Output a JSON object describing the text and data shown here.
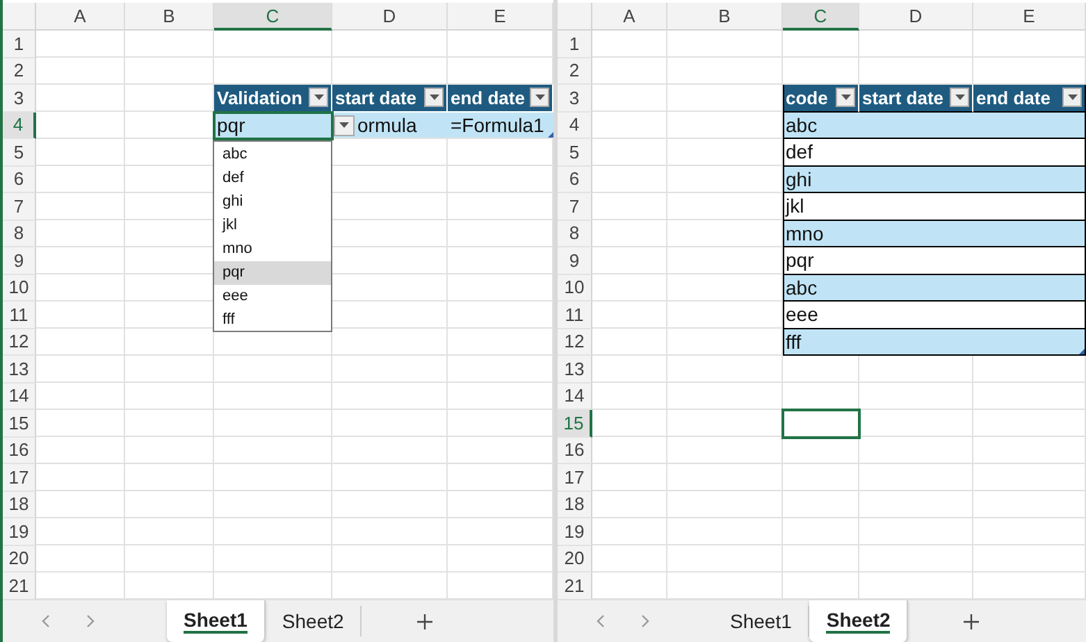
{
  "panes": [
    {
      "columns": [
        {
          "label": "A",
          "selected": false
        },
        {
          "label": "B",
          "selected": false
        },
        {
          "label": "C",
          "selected": true
        },
        {
          "label": "D",
          "selected": false
        },
        {
          "label": "E",
          "selected": false
        }
      ],
      "rows": [
        {
          "label": "1",
          "selected": false
        },
        {
          "label": "2",
          "selected": false
        },
        {
          "label": "3",
          "selected": false,
          "cells": [
            {
              "kind": "empty"
            },
            {
              "kind": "empty"
            },
            {
              "kind": "header",
              "text": "Validation"
            },
            {
              "kind": "header",
              "text": "start date"
            },
            {
              "kind": "header",
              "text": "end date"
            }
          ]
        },
        {
          "label": "4",
          "selected": true,
          "cells": [
            {
              "kind": "empty"
            },
            {
              "kind": "empty"
            },
            {
              "kind": "value",
              "text": "pqr",
              "banded": true,
              "active": true,
              "dropdown": {
                "items": [
                  {
                    "label": "abc",
                    "selected": false
                  },
                  {
                    "label": "def",
                    "selected": false
                  },
                  {
                    "label": "ghi",
                    "selected": false
                  },
                  {
                    "label": "jkl",
                    "selected": false
                  },
                  {
                    "label": "mno",
                    "selected": false
                  },
                  {
                    "label": "pqr",
                    "selected": true
                  },
                  {
                    "label": "eee",
                    "selected": false
                  },
                  {
                    "label": "fff",
                    "selected": false
                  }
                ]
              }
            },
            {
              "kind": "value",
              "text": "ormula",
              "banded": true
            },
            {
              "kind": "value",
              "text": "=Formula1",
              "banded": true,
              "corner_handle": true
            }
          ]
        },
        {
          "label": "5",
          "selected": false
        },
        {
          "label": "6",
          "selected": false
        },
        {
          "label": "7",
          "selected": false
        },
        {
          "label": "8",
          "selected": false
        },
        {
          "label": "9",
          "selected": false
        },
        {
          "label": "10",
          "selected": false
        },
        {
          "label": "11",
          "selected": false
        },
        {
          "label": "12",
          "selected": false
        },
        {
          "label": "13",
          "selected": false
        },
        {
          "label": "14",
          "selected": false
        },
        {
          "label": "15",
          "selected": false
        },
        {
          "label": "16",
          "selected": false
        },
        {
          "label": "17",
          "selected": false
        },
        {
          "label": "18",
          "selected": false
        },
        {
          "label": "19",
          "selected": false
        },
        {
          "label": "20",
          "selected": false
        },
        {
          "label": "21",
          "selected": false
        }
      ],
      "sheet_tabs": [
        {
          "label": "Sheet1",
          "selected": true
        },
        {
          "label": "Sheet2",
          "selected": false
        }
      ]
    },
    {
      "columns": [
        {
          "label": "A",
          "selected": false
        },
        {
          "label": "B",
          "selected": false
        },
        {
          "label": "C",
          "selected": true
        },
        {
          "label": "D",
          "selected": false
        },
        {
          "label": "E",
          "selected": false
        }
      ],
      "rows": [
        {
          "label": "1",
          "selected": false
        },
        {
          "label": "2",
          "selected": false
        },
        {
          "label": "3",
          "selected": false,
          "cells": [
            {
              "kind": "empty"
            },
            {
              "kind": "empty"
            },
            {
              "kind": "header",
              "text": "code",
              "outlined": true
            },
            {
              "kind": "header",
              "text": "start date",
              "outlined": true
            },
            {
              "kind": "header",
              "text": "end date",
              "outlined": true
            }
          ]
        },
        {
          "label": "4",
          "selected": false,
          "cells": [
            {
              "kind": "empty"
            },
            {
              "kind": "empty"
            },
            {
              "kind": "value",
              "text": "abc",
              "banded": true,
              "outlined": true
            },
            {
              "kind": "value",
              "banded": true,
              "outlined": true
            },
            {
              "kind": "value",
              "banded": true,
              "outlined": true
            }
          ]
        },
        {
          "label": "5",
          "selected": false,
          "cells": [
            {
              "kind": "empty"
            },
            {
              "kind": "empty"
            },
            {
              "kind": "value",
              "text": "def",
              "banded": false,
              "outlined": true
            },
            {
              "kind": "value",
              "banded": false,
              "outlined": true
            },
            {
              "kind": "value",
              "banded": false,
              "outlined": true
            }
          ]
        },
        {
          "label": "6",
          "selected": false,
          "cells": [
            {
              "kind": "empty"
            },
            {
              "kind": "empty"
            },
            {
              "kind": "value",
              "text": "ghi",
              "banded": true,
              "outlined": true
            },
            {
              "kind": "value",
              "banded": true,
              "outlined": true
            },
            {
              "kind": "value",
              "banded": true,
              "outlined": true
            }
          ]
        },
        {
          "label": "7",
          "selected": false,
          "cells": [
            {
              "kind": "empty"
            },
            {
              "kind": "empty"
            },
            {
              "kind": "value",
              "text": "jkl",
              "banded": false,
              "outlined": true
            },
            {
              "kind": "value",
              "banded": false,
              "outlined": true
            },
            {
              "kind": "value",
              "banded": false,
              "outlined": true
            }
          ]
        },
        {
          "label": "8",
          "selected": false,
          "cells": [
            {
              "kind": "empty"
            },
            {
              "kind": "empty"
            },
            {
              "kind": "value",
              "text": "mno",
              "banded": true,
              "outlined": true
            },
            {
              "kind": "value",
              "banded": true,
              "outlined": true
            },
            {
              "kind": "value",
              "banded": true,
              "outlined": true
            }
          ]
        },
        {
          "label": "9",
          "selected": false,
          "cells": [
            {
              "kind": "empty"
            },
            {
              "kind": "empty"
            },
            {
              "kind": "value",
              "text": "pqr",
              "banded": false,
              "outlined": true
            },
            {
              "kind": "value",
              "banded": false,
              "outlined": true
            },
            {
              "kind": "value",
              "banded": false,
              "outlined": true
            }
          ]
        },
        {
          "label": "10",
          "selected": false,
          "cells": [
            {
              "kind": "empty"
            },
            {
              "kind": "empty"
            },
            {
              "kind": "value",
              "text": "abc",
              "banded": true,
              "outlined": true
            },
            {
              "kind": "value",
              "banded": true,
              "outlined": true
            },
            {
              "kind": "value",
              "banded": true,
              "outlined": true
            }
          ]
        },
        {
          "label": "11",
          "selected": false,
          "cells": [
            {
              "kind": "empty"
            },
            {
              "kind": "empty"
            },
            {
              "kind": "value",
              "text": "eee",
              "banded": false,
              "outlined": true
            },
            {
              "kind": "value",
              "banded": false,
              "outlined": true
            },
            {
              "kind": "value",
              "banded": false,
              "outlined": true
            }
          ]
        },
        {
          "label": "12",
          "selected": false,
          "cells": [
            {
              "kind": "empty"
            },
            {
              "kind": "empty"
            },
            {
              "kind": "value",
              "text": "fff",
              "banded": true,
              "outlined": true
            },
            {
              "kind": "value",
              "banded": true,
              "outlined": true
            },
            {
              "kind": "value",
              "banded": true,
              "outlined": true,
              "corner_handle": true
            }
          ]
        },
        {
          "label": "13",
          "selected": false
        },
        {
          "label": "14",
          "selected": false
        },
        {
          "label": "15",
          "selected": true,
          "cells": [
            {
              "kind": "empty"
            },
            {
              "kind": "empty"
            },
            {
              "kind": "empty",
              "active": true
            },
            {
              "kind": "empty"
            },
            {
              "kind": "empty"
            }
          ]
        },
        {
          "label": "16",
          "selected": false
        },
        {
          "label": "17",
          "selected": false
        },
        {
          "label": "18",
          "selected": false
        },
        {
          "label": "19",
          "selected": false
        },
        {
          "label": "20",
          "selected": false
        },
        {
          "label": "21",
          "selected": false
        }
      ],
      "sheet_tabs": [
        {
          "label": "Sheet1",
          "selected": false
        },
        {
          "label": "Sheet2",
          "selected": true
        }
      ]
    }
  ]
}
